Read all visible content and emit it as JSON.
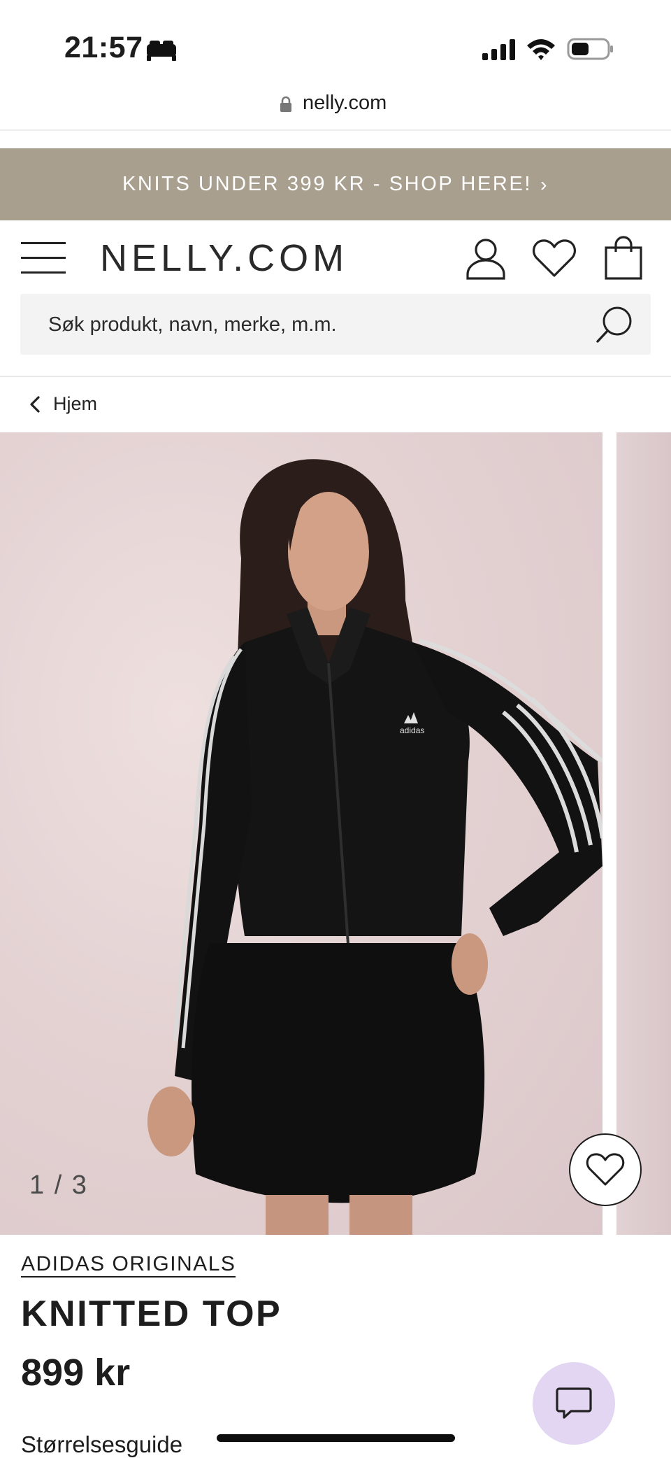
{
  "status_bar": {
    "time": "21:57",
    "icons": [
      "sleep-bed-icon",
      "signal-icon",
      "wifi-icon",
      "battery-icon"
    ]
  },
  "browser": {
    "url": "nelly.com"
  },
  "promo": {
    "text": "KNITS UNDER 399 KR - SHOP HERE!",
    "chevron": "›"
  },
  "header": {
    "logo": "NELLY.COM",
    "icons": [
      "menu-icon",
      "account-icon",
      "wishlist-icon",
      "bag-icon"
    ]
  },
  "search": {
    "placeholder": "Søk produkt, navn, merke, m.m."
  },
  "breadcrumb": {
    "back_label": "Hjem"
  },
  "gallery": {
    "counter": "1 / 3",
    "current_image": 1,
    "total_images": 3
  },
  "product": {
    "brand": "ADIDAS ORIGINALS",
    "name": "KNITTED TOP",
    "price": "899 kr",
    "size_guide": "Størrelsesguide"
  },
  "colors": {
    "promo_bg": "#a99f8e",
    "chat_bg": "#e2d6f3",
    "search_bg": "#f3f3f3"
  }
}
